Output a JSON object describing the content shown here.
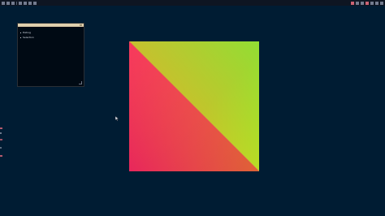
{
  "debug_window": {
    "items": [
      "Debug",
      "Selection"
    ]
  },
  "colors": {
    "workspace_bg": "#001c33",
    "panel_bg": "#000a14",
    "titlebar": "#dfcfad",
    "gradient_green": "#73ff35",
    "gradient_magenta": "#e8195e",
    "gradient_yellow": "#c9da13"
  },
  "icons": {
    "cursor": "mouse-pointer-icon"
  }
}
